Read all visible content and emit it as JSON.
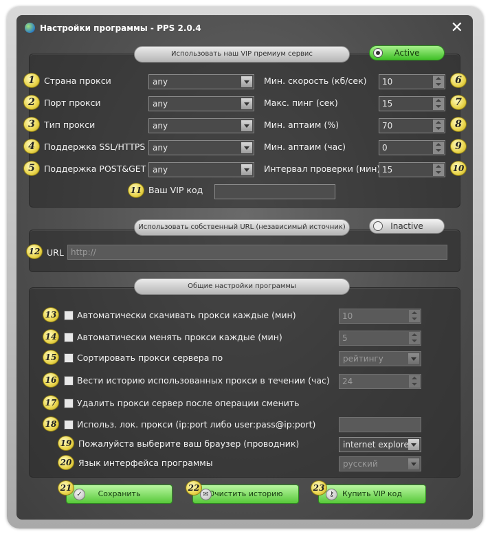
{
  "window": {
    "title": "Настройки программы - PPS 2.0.4",
    "close_glyph": "✕"
  },
  "vip": {
    "header": "Использовать наш VIP премиум сервис",
    "toggle_label": "Active",
    "left_rows": [
      {
        "badge": "1",
        "label": "Страна прокси",
        "value": "any"
      },
      {
        "badge": "2",
        "label": "Порт прокси",
        "value": "any"
      },
      {
        "badge": "3",
        "label": "Тип прокси",
        "value": "any"
      },
      {
        "badge": "4",
        "label": "Поддержка SSL/HTTPS",
        "value": "any"
      },
      {
        "badge": "5",
        "label": "Поддержка POST&GET",
        "value": "any"
      }
    ],
    "right_rows": [
      {
        "badge": "6",
        "label": "Мин. скорость (кб/сек)",
        "value": "10"
      },
      {
        "badge": "7",
        "label": "Макс. пинг (сек)",
        "value": "15"
      },
      {
        "badge": "8",
        "label": "Мин. аптаим (%)",
        "value": "70"
      },
      {
        "badge": "9",
        "label": "Мин. аптаим (час)",
        "value": "0"
      },
      {
        "badge": "10",
        "label": "Интервал проверки (мин)",
        "value": "15"
      }
    ],
    "code": {
      "badge": "11",
      "label": "Ваш VIP код",
      "value": ""
    }
  },
  "url": {
    "header": "Использовать собственный URL (независимый источник)",
    "toggle_label": "Inactive",
    "badge": "12",
    "label": "URL",
    "value": "http://"
  },
  "general": {
    "header": "Общие настройки программы",
    "rows": [
      {
        "badge": "13",
        "label": "Автоматически скачивать прокси каждые (мин)",
        "value": "10"
      },
      {
        "badge": "14",
        "label": "Автоматически менять прокси каждые (мин)",
        "value": "5"
      },
      {
        "badge": "15",
        "label": "Сортировать прокси сервера по",
        "value": "рейтингу"
      },
      {
        "badge": "16",
        "label": "Вести историю использованных прокси в течении (час)",
        "value": "24"
      },
      {
        "badge": "17",
        "label": "Удалить прокси сервер после операции сменить"
      },
      {
        "badge": "18",
        "label": "Использ. лок. прокси (ip:port либо user:pass@ip:port)",
        "value": ""
      },
      {
        "badge": "19",
        "label": "Пожалуйста выберите ваш браузер (проводник)",
        "value": "internet explorer"
      },
      {
        "badge": "20",
        "label": "Язык интерфейса программы",
        "value": "русский"
      }
    ]
  },
  "buttons": [
    {
      "badge": "21",
      "label": "Сохранить",
      "icon": "check-icon"
    },
    {
      "badge": "22",
      "label": "Очистить историю",
      "icon": "envelope-icon"
    },
    {
      "badge": "23",
      "label": "Купить VIP код",
      "icon": "key-icon"
    }
  ],
  "colors": {
    "accent_green": "#58c93a",
    "badge_yellow": "#e9d44a"
  }
}
